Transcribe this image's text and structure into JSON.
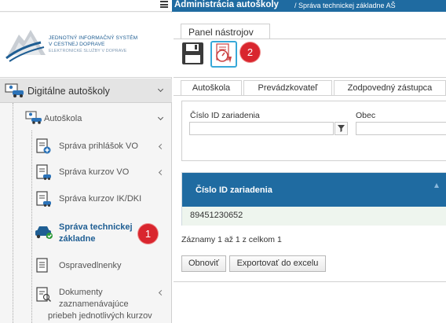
{
  "header": {
    "title": "Administrácia autoškoly",
    "breadcrumb": "/ Správa technickej základne AŠ"
  },
  "logo": {
    "line1": "JEDNOTNÝ INFORMAČNÝ SYSTÉM",
    "line2": "V CESTNEJ DOPRAVE",
    "line3": "ELEKTRONICKÉ SLUŽBY V DOPRAVE"
  },
  "sidebar": {
    "section": "Digitálne autoškoly",
    "group": "Autoškola",
    "items": [
      {
        "label": "Správa prihlášok VO"
      },
      {
        "label": "Správa kurzov VO"
      },
      {
        "label": "Správa kurzov IK/DKI"
      },
      {
        "label1": "Správa technickej",
        "label2": "základne"
      },
      {
        "label": "Ospravedlnenky"
      },
      {
        "label1": "Dokumenty",
        "label2": "zaznamenávajúce",
        "label3": "priebeh jednotlivých kurzov"
      }
    ]
  },
  "toolbar": {
    "panel_label": "Panel nástrojov"
  },
  "badges": {
    "one": "1",
    "two": "2"
  },
  "tabs": [
    "Autoškola",
    "Prevádzkovateľ",
    "Zodpovedný zástupca"
  ],
  "filter": {
    "cislo_label": "Číslo ID zariadenia",
    "cislo_value": "",
    "obec_label": "Obec",
    "obec_value": ""
  },
  "grid": {
    "column": "Číslo ID zariadenia",
    "rows": [
      "89451230652"
    ],
    "summary": "Záznamy 1 až 1 z celkom 1"
  },
  "buttons": {
    "refresh": "Obnoviť",
    "export": "Exportovať do excelu"
  },
  "colors": {
    "header": "#1f6ba1",
    "badge": "#d9262e",
    "highlight": "#38a8d8"
  }
}
